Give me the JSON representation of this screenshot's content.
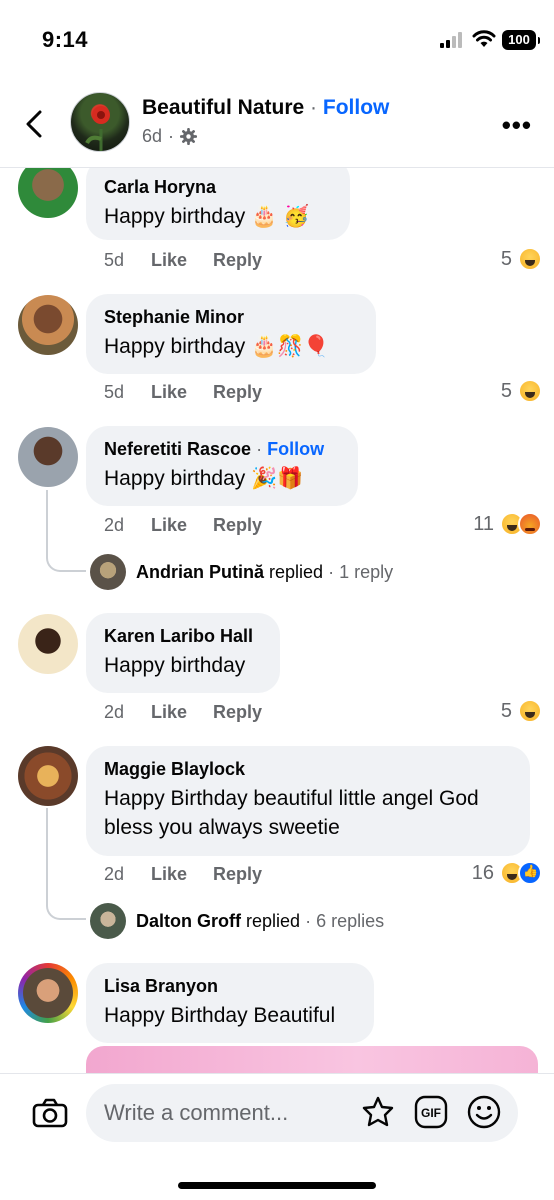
{
  "status_bar": {
    "time": "9:14",
    "battery": "100"
  },
  "header": {
    "page_name": "Beautiful Nature",
    "separator": "·",
    "follow_label": "Follow",
    "post_age": "6d",
    "meta_separator": "·"
  },
  "comments": [
    {
      "author": "Carla Horyna",
      "text": "Happy birthday 🎂 🥳",
      "time": "5d",
      "like": "Like",
      "reply": "Reply",
      "reaction_count": "5"
    },
    {
      "author": "Stephanie Minor",
      "text": "Happy birthday 🎂🎊🎈",
      "time": "5d",
      "like": "Like",
      "reply": "Reply",
      "reaction_count": "5"
    },
    {
      "author": "Neferetiti Rascoe",
      "follow": "Follow",
      "separator": "·",
      "text": "Happy birthday 🎉🎁",
      "time": "2d",
      "like": "Like",
      "reply": "Reply",
      "reaction_count": "11",
      "reply_preview": {
        "name": "Andrian Putină",
        "action": "replied",
        "meta": "· 1 reply"
      }
    },
    {
      "author": "Karen Laribo Hall",
      "text": "Happy birthday",
      "time": "2d",
      "like": "Like",
      "reply": "Reply",
      "reaction_count": "5"
    },
    {
      "author": "Maggie Blaylock",
      "text_line1": "Happy Birthday beautiful little angel God",
      "text_line2": "bless you always sweetie",
      "time": "2d",
      "like": "Like",
      "reply": "Reply",
      "reaction_count": "16",
      "reply_preview": {
        "name": "Dalton Groff",
        "action": "replied",
        "meta": "· 6 replies"
      }
    },
    {
      "author": "Lisa Branyon",
      "text": "Happy Birthday Beautiful"
    }
  ],
  "composer": {
    "placeholder": "Write a comment..."
  },
  "icons": {
    "back": "chevron-left-icon",
    "more": "more-horizontal-icon",
    "settings": "gear-icon",
    "camera": "camera-icon",
    "sticker": "sticker-icon",
    "gif": "gif-icon",
    "emoji": "emoji-icon"
  },
  "colors": {
    "accent": "#0866ff",
    "bubble": "#f0f2f5",
    "secondary_text": "#65676b"
  }
}
